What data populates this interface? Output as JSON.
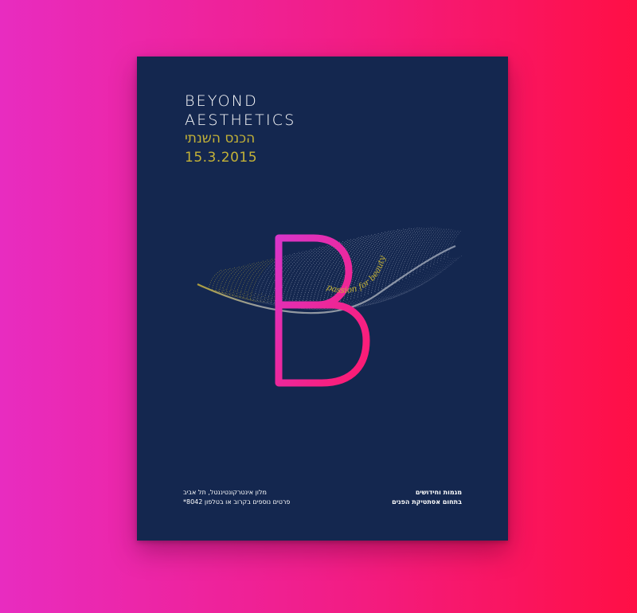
{
  "poster": {
    "title_line1": "BEYOND",
    "title_line2": "AESTHETICS",
    "hebrew_subtitle": "הכנס השנתי",
    "date": "15.3.2015",
    "logo_letter": "B",
    "tagline": "passion for beauty",
    "footer_left": {
      "line1": "מלון אינטרקונטיננטל, תל אביב",
      "line2": "פרטים נוספים בקרוב או בטלפון 8042*"
    },
    "footer_right": {
      "line1": "מגמות וחידושים",
      "line2": "בתחום אסתטיקת הפנים"
    }
  },
  "colors": {
    "background_left": "#e82cc0",
    "background_right": "#ff0f45",
    "poster_bg": "#14274f",
    "accent_gold": "#c4b237",
    "letter_pink": "#f0288c"
  }
}
